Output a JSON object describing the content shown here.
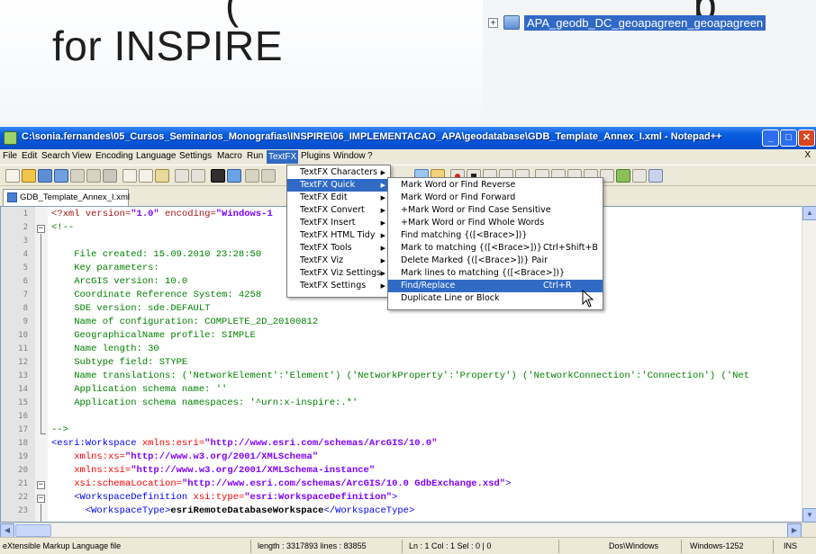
{
  "slide": {
    "title": "for INSPIRE",
    "title_top_fragment": "(",
    "title_top_right": "p",
    "catalog_item": "APA_geodb_DC_geoapagreen_geoapagreen"
  },
  "window": {
    "title": "C:\\sonia.fernandes\\05_Cursos_Seminarios_Monografias\\INSPIRE\\06_IMPLEMENTACAO_APA\\geodatabase\\GDB_Template_Annex_I.xml - Notepad++"
  },
  "menubar": [
    "File",
    "Edit",
    "Search",
    "View",
    "Encoding",
    "Language",
    "Settings",
    "Macro",
    "Run",
    "TextFX",
    "Plugins",
    "Window",
    "?"
  ],
  "menubar_close": "X",
  "tab": {
    "label": "GDB_Template_Annex_I.xml"
  },
  "textfx_menu": [
    "TextFX Characters",
    "TextFX Quick",
    "TextFX Edit",
    "TextFX Convert",
    "TextFX Insert",
    "TextFX HTML Tidy",
    "TextFX Tools",
    "TextFX Viz",
    "TextFX Viz Settings",
    "TextFX Settings"
  ],
  "quick_submenu": [
    {
      "label": "Mark Word or Find Reverse",
      "shortcut": ""
    },
    {
      "label": "Mark Word or Find Forward",
      "shortcut": ""
    },
    {
      "label": "+Mark Word or Find Case Sensitive",
      "shortcut": ""
    },
    {
      "label": "+Mark Word or Find Whole Words",
      "shortcut": ""
    },
    {
      "label": "Find matching {([<Brace>])}",
      "shortcut": ""
    },
    {
      "label": "Mark to matching {([<Brace>])}",
      "shortcut": "Ctrl+Shift+B"
    },
    {
      "label": "Delete Marked {([<Brace>])} Pair",
      "shortcut": ""
    },
    {
      "label": "Mark lines to matching {([<Brace>])}",
      "shortcut": ""
    },
    {
      "label": "Find/Replace",
      "shortcut": "Ctrl+R"
    },
    {
      "label": "Duplicate Line or Block",
      "shortcut": ""
    }
  ],
  "editor": {
    "line_numbers": [
      "1",
      "2",
      "3",
      "4",
      "5",
      "6",
      "7",
      "8",
      "9",
      "10",
      "11",
      "12",
      "13",
      "14",
      "15",
      "16",
      "17",
      "18",
      "19",
      "20",
      "21",
      "22",
      "23"
    ],
    "lines": {
      "l1a": "<?xml version=",
      "l1b": "\"1.0\"",
      "l1c": " encoding=",
      "l1d": "\"Windows-1",
      "l2": "<!--",
      "l4": "    File created: 15.09.2010 23:28:50",
      "l5": "    Key parameters:",
      "l6": "    ArcGIS version: 10.0",
      "l7": "    Coordinate Reference System: 4258",
      "l8": "    SDE version: sde.DEFAULT",
      "l9": "    Name of configuration: COMPLETE_2D_20100812",
      "l10": "    GeographicalName profile: SIMPLE",
      "l11": "    Name length: 30",
      "l12": "    Subtype field: STYPE",
      "l13": "    Name translations: ('NetworkElement':'Element') ('NetworkProperty':'Property') ('NetworkConnection':'Connection') ('Net",
      "l14": "    Application schema name: ''",
      "l15": "    Application schema namespaces: '^urn:x-inspire:.*'",
      "l17": "-->",
      "l18a": "<esri:Workspace ",
      "l18b": "xmlns:esri=",
      "l18c": "\"http://www.esri.com/schemas/ArcGIS/10.0\"",
      "l19a": "    xmlns:xs=",
      "l19b": "\"http://www.w3.org/2001/XMLSchema\"",
      "l20a": "    xmlns:xsi=",
      "l20b": "\"http://www.w3.org/2001/XMLSchema-instance\"",
      "l21a": "    xsi:schemaLocation=",
      "l21b": "\"http://www.esri.com/schemas/ArcGIS/10.0 GdbExchange.xsd\"",
      "l21c": ">",
      "l22a": "    <WorkspaceDefinition ",
      "l22b": "xsi:type=",
      "l22c": "\"esri:WorkspaceDefinition\"",
      "l22d": ">",
      "l23a": "      <WorkspaceType>",
      "l23b": "esriRemoteDatabaseWorkspace",
      "l23c": "</WorkspaceType>"
    }
  },
  "status": {
    "filetype": "eXtensible Markup Language file",
    "length": "length : 3317893    lines : 83855",
    "position": "Ln : 1    Col : 1    Sel : 0 | 0",
    "eol": "Dos\\Windows",
    "encoding": "Windows-1252",
    "mode": "INS"
  },
  "colors": {
    "titlebar": "#0553d6",
    "selection": "#316ac5",
    "xml_tag": "#0000ff",
    "xml_attr": "#ff0000",
    "xml_string": "#8000ff",
    "xml_comment": "#008000"
  }
}
